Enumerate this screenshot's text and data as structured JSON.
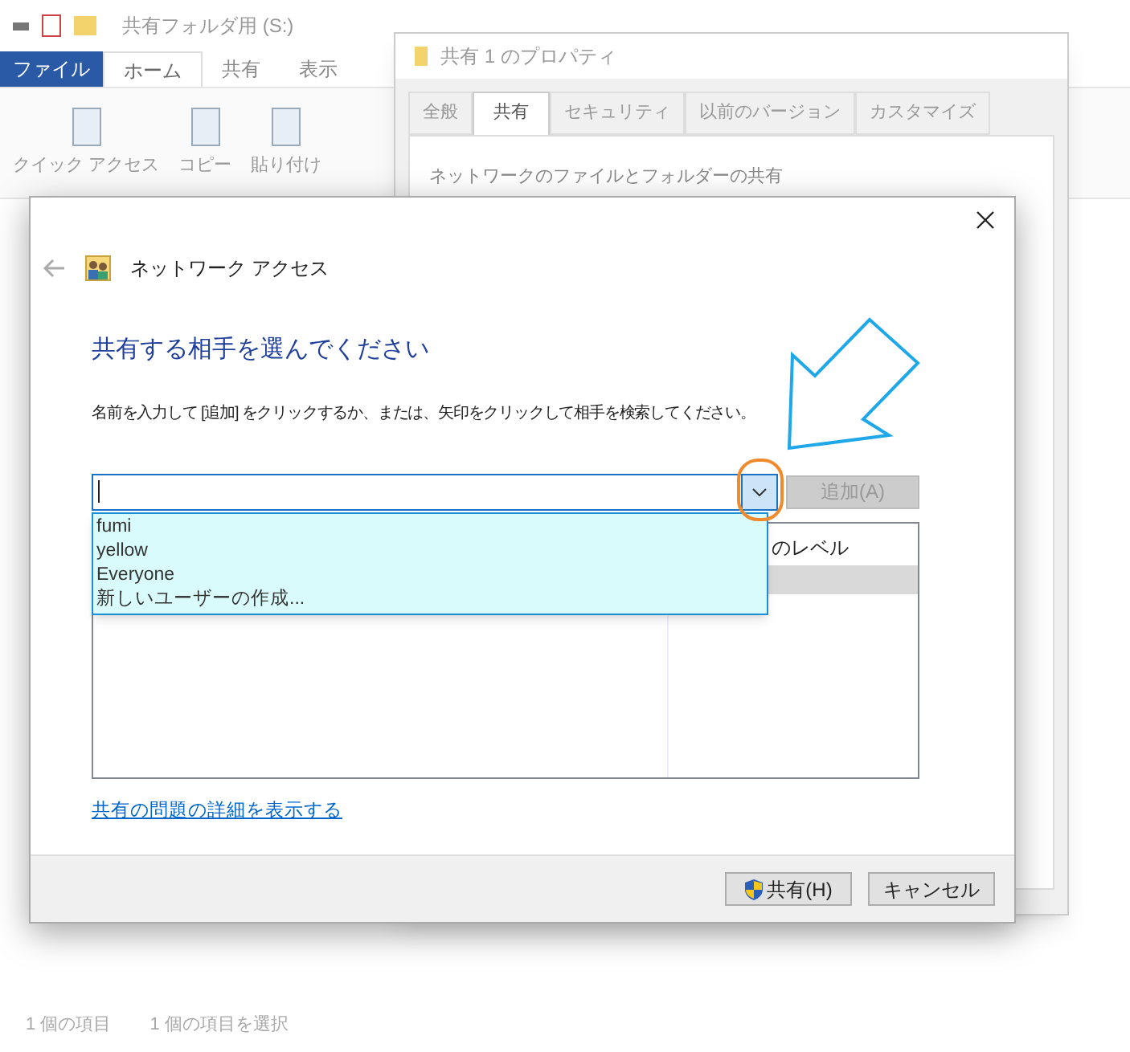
{
  "explorer": {
    "title": "共有フォルダ用 (S:)",
    "ribbon_tabs": [
      {
        "label": "ファイル",
        "kind": "file"
      },
      {
        "label": "ホーム",
        "kind": "tab",
        "selected": true
      },
      {
        "label": "共有",
        "kind": "tab",
        "selected": false
      },
      {
        "label": "表示",
        "kind": "tab",
        "selected": false
      }
    ],
    "ribbon_buttons": [
      "クイック アクセス",
      "コピー",
      "貼り付け"
    ],
    "status_bar": [
      "1 個の項目",
      "1 個の項目を選択"
    ]
  },
  "properties": {
    "title": "共有 1 のプロパティ",
    "tabs": [
      {
        "label": "全般",
        "selected": false
      },
      {
        "label": "共有",
        "selected": true
      },
      {
        "label": "セキュリティ",
        "selected": false
      },
      {
        "label": "以前のバージョン",
        "selected": false
      },
      {
        "label": "カスタマイズ",
        "selected": false
      }
    ],
    "group_title": "ネットワークのファイルとフォルダーの共有"
  },
  "dialog": {
    "title": "ネットワーク アクセス",
    "heading": "共有する相手を選んでください",
    "instruction": "名前を入力して [追加] をクリックするか、または、矢印をクリックして相手を検索してください。",
    "dropdown": {
      "expanded": true,
      "items": [
        "fumi",
        "yellow",
        "Everyone",
        "新しいユーザーの作成..."
      ]
    },
    "add_button": {
      "label": "追加(A)",
      "disabled": true
    },
    "permission_column_header": "のレベル",
    "link": "共有の問題の詳細を表示する",
    "buttons": [
      {
        "label": "共有(H)",
        "kind": "shield"
      },
      {
        "label": "キャンセル",
        "kind": "plain"
      }
    ]
  }
}
